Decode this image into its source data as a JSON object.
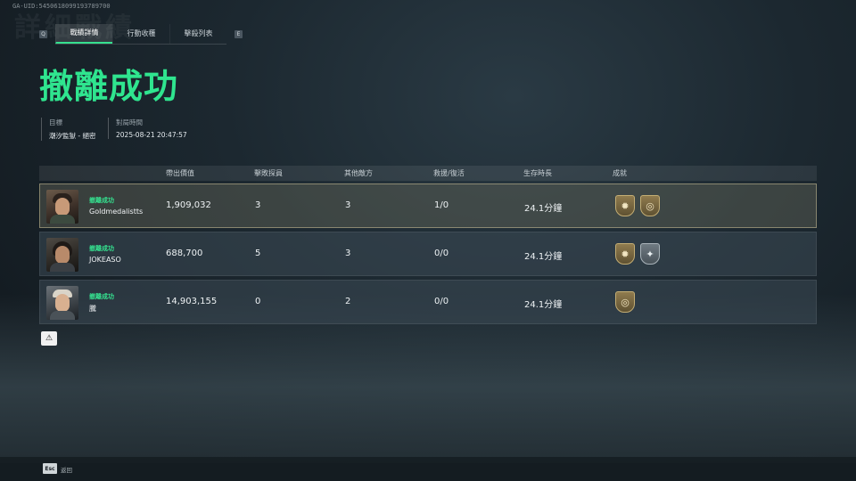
{
  "uid": "GA-UID:5450618099193789700",
  "watermark": "詳細戰績",
  "tabs": {
    "left_key": "Q",
    "right_key": "E",
    "items": [
      {
        "label": "戰績詳情",
        "active": true
      },
      {
        "label": "行動收穫",
        "active": false
      },
      {
        "label": "擊殺列表",
        "active": false
      }
    ]
  },
  "result_title": "撤離成功",
  "meta": {
    "target_label": "目標",
    "target_value": "潮汐監獄 - 絕密",
    "time_label": "對局時間",
    "time_value": "2025-08-21 20:47:57"
  },
  "table": {
    "headers": [
      "帶出價值",
      "擊敗探員",
      "其他敵方",
      "救援/復活",
      "生存時長",
      "成就"
    ],
    "rows": [
      {
        "status": "撤離成功",
        "name": "Goldmedalistts",
        "value": "1,909,032",
        "kills": "3",
        "others": "3",
        "rescue": "1/0",
        "survival": "24.1分鐘",
        "highlight": true,
        "badges": [
          "gold-sun-badge",
          "gold-target-badge"
        ]
      },
      {
        "status": "撤離成功",
        "name": "JOKEASO",
        "value": "688,700",
        "kills": "5",
        "others": "3",
        "rescue": "0/0",
        "survival": "24.1分鐘",
        "highlight": false,
        "badges": [
          "gold-sun-badge",
          "silver-star-badge"
        ]
      },
      {
        "status": "撤離成功",
        "name": "騰",
        "value": "14,903,155",
        "kills": "0",
        "others": "2",
        "rescue": "0/0",
        "survival": "24.1分鐘",
        "highlight": false,
        "badges": [
          "gold-target-badge"
        ]
      }
    ]
  },
  "footer": {
    "esc_key": "Esc",
    "back_label": "返回"
  },
  "colors": {
    "accent_green": "#2fe58f",
    "gold_badge": "#8f7b4e",
    "silver_badge": "#6f7a82"
  }
}
